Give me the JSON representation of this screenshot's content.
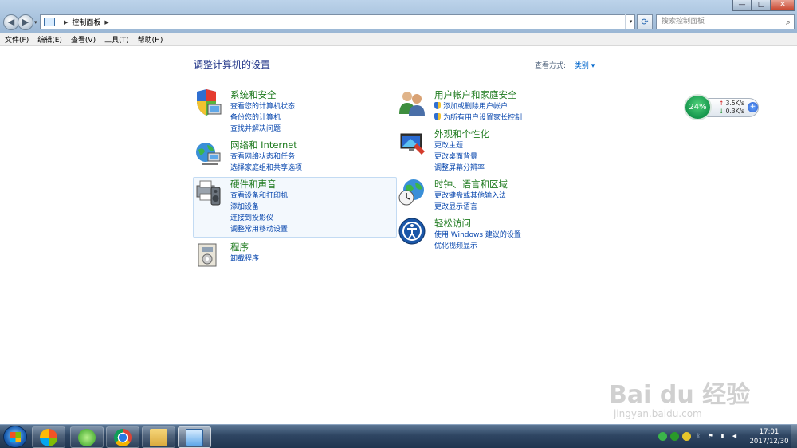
{
  "window": {
    "breadcrumb": [
      "控制面板"
    ],
    "search_placeholder": "搜索控制面板",
    "controls": {
      "minimize": "—",
      "maximize": "□",
      "close": "✕"
    }
  },
  "menu": [
    "文件(F)",
    "编辑(E)",
    "查看(V)",
    "工具(T)",
    "帮助(H)"
  ],
  "page": {
    "title": "调整计算机的设置",
    "view_by_label": "查看方式:",
    "view_by_value": "类别 ▾"
  },
  "categories": [
    {
      "title": "系统和安全",
      "icon": "shield-computer-icon",
      "links": [
        "查看您的计算机状态",
        "备份您的计算机",
        "查找并解决问题"
      ]
    },
    {
      "title": "网络和 Internet",
      "icon": "network-globe-icon",
      "links": [
        "查看网络状态和任务",
        "选择家庭组和共享选项"
      ]
    },
    {
      "title": "硬件和声音",
      "icon": "printer-speaker-icon",
      "links": [
        "查看设备和打印机",
        "添加设备",
        "连接到投影仪",
        "调整常用移动设置"
      ]
    },
    {
      "title": "程序",
      "icon": "programs-icon",
      "links": [
        "卸载程序"
      ]
    },
    {
      "title": "用户帐户和家庭安全",
      "icon": "users-icon",
      "links": [
        "添加或删除用户帐户",
        "为所有用户设置家长控制"
      ]
    },
    {
      "title": "外观和个性化",
      "icon": "display-icon",
      "links": [
        "更改主题",
        "更改桌面背景",
        "调整屏幕分辨率"
      ]
    },
    {
      "title": "时钟、语言和区域",
      "icon": "clock-globe-icon",
      "links": [
        "更改键盘或其他输入法",
        "更改显示语言"
      ]
    },
    {
      "title": "轻松访问",
      "icon": "ease-of-access-icon",
      "links": [
        "使用 Windows 建议的设置",
        "优化视频显示"
      ]
    }
  ],
  "net_widget": {
    "percent": "24%",
    "up": "3.5K/s",
    "down": "0.3K/s"
  },
  "watermark": {
    "main": "Bai du 经验",
    "sub": "jingyan.baidu.com"
  },
  "taskbar": {
    "apps": [
      "launcher-icon",
      "ie-icon",
      "chrome-icon",
      "explorer-icon",
      "control-panel-icon"
    ],
    "time": "17:01",
    "date": "2017/12/30"
  }
}
